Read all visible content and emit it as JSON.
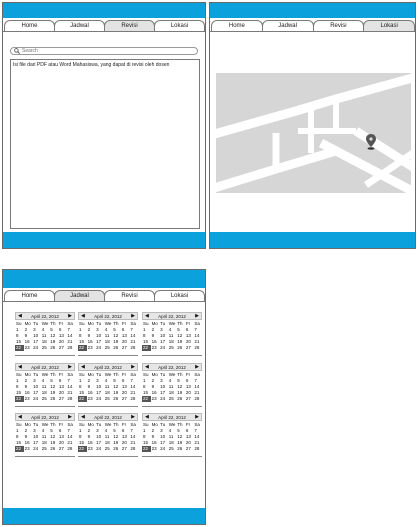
{
  "accent_color": "#0aa1dd",
  "revisi_screen": {
    "tabs": [
      "Home",
      "Jadwal",
      "Revisi",
      "Lokasi"
    ],
    "active_tab": "Revisi",
    "search_placeholder": "Search",
    "text_content": "Isi file dari PDF atau Word Mahasiswa, yang dapat di revisi oleh dosen"
  },
  "lokasi_screen": {
    "tabs": [
      "Home",
      "Jadwal",
      "Revisi",
      "Lokasi"
    ],
    "active_tab": "Lokasi",
    "map_icons": [
      "map-pin-icon"
    ]
  },
  "jadwal_screen": {
    "tabs": [
      "Home",
      "Jadwal",
      "Revisi",
      "Lokasi"
    ],
    "active_tab": "Jadwal",
    "calendar": {
      "month_label": "April 22, 2012",
      "weekdays": [
        "Su",
        "Mo",
        "Tu",
        "We",
        "Th",
        "Fr",
        "Sa"
      ],
      "visible_days": [
        "1",
        "2",
        "3",
        "4",
        "5",
        "6",
        "7",
        "8",
        "9",
        "10",
        "11",
        "12",
        "13",
        "14",
        "15",
        "16",
        "17",
        "18",
        "19",
        "20",
        "21",
        "22",
        "23",
        "24",
        "25",
        "26",
        "27",
        "28"
      ],
      "selected_day": "22",
      "prev_icon": "triangle-left-icon",
      "next_icon": "triangle-right-icon"
    },
    "calendar_count": 9
  }
}
